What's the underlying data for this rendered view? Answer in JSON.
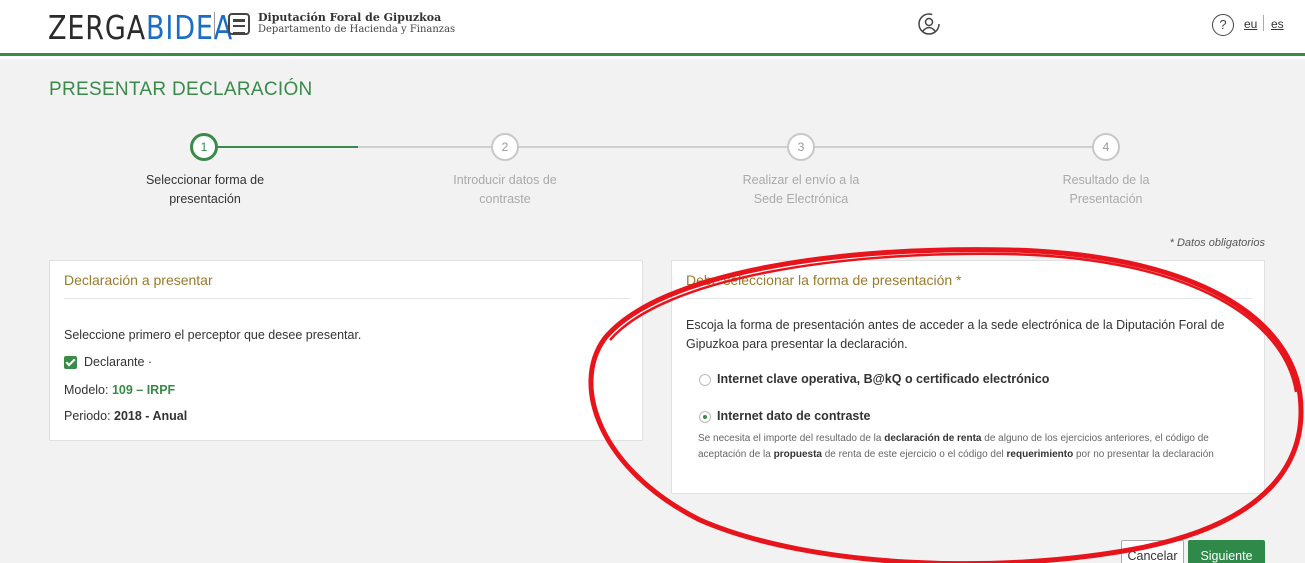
{
  "header": {
    "logo_left": "ZERGA",
    "logo_right": "BIDEA",
    "org_title": "Diputación Foral de Gipuzkoa",
    "org_subtitle": "Departamento de Hacienda y Finanzas",
    "help_icon_glyph": "?",
    "lang_eu": "eu",
    "lang_es": "es",
    "icons": [
      "user-icon",
      "help-icon",
      "seal-icon"
    ]
  },
  "page": {
    "title": "PRESENTAR DECLARACIÓN",
    "required_note": "* Datos obligatorios"
  },
  "steps": [
    {
      "number": "1",
      "line1": "Seleccionar forma de",
      "line2": "presentación",
      "active": true
    },
    {
      "number": "2",
      "line1": "Introducir datos de",
      "line2": "contraste",
      "active": false
    },
    {
      "number": "3",
      "line1": "Realizar el envío a la",
      "line2": "Sede Electrónica",
      "active": false
    },
    {
      "number": "4",
      "line1": "Resultado de la",
      "line2": "Presentación",
      "active": false
    }
  ],
  "left_panel": {
    "title": "Declaración a presentar",
    "instruction": "Seleccione primero el perceptor que desee presentar.",
    "declarant_label": "Declarante ·",
    "modelo_label": "Modelo: ",
    "modelo_value": "109 – IRPF",
    "periodo_label": "Periodo: ",
    "periodo_value": "2018 - Anual"
  },
  "right_panel": {
    "title": "Debe seleccionar la forma de presentación *",
    "intro": "Escoja la forma de presentación antes de acceder a la sede electrónica de la Diputación Foral de Gipuzkoa para presentar la declaración.",
    "option1": "Internet clave operativa, B@kQ o certificado electrónico",
    "option2": "Internet dato de contraste",
    "note_p1": "Se necesita el importe del resultado de la ",
    "note_b1": "declaración de renta",
    "note_p2": " de alguno de los ejercicios anteriores, el código de aceptación de la ",
    "note_b2": "propuesta",
    "note_p3": " de renta de este ejercicio o el código del ",
    "note_b3": "requerimiento",
    "note_p4": " por no presentar la declaración",
    "selected_option": "option2"
  },
  "buttons": {
    "cancel": "Cancelar",
    "next": "Siguiente"
  },
  "colors": {
    "brand_green": "#3a8a4a",
    "panel_title": "#9a7a2a",
    "annotation_red": "#e8141c",
    "logo_blue": "#1a6fc4"
  }
}
